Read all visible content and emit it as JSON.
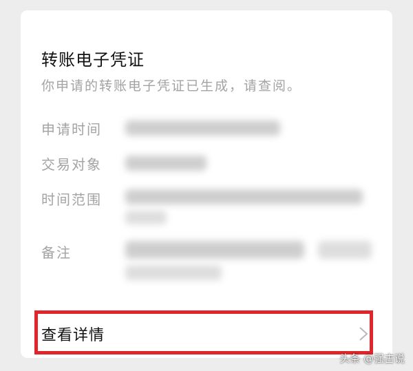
{
  "card": {
    "title": "转账电子凭证",
    "subtitle": "你申请的转账电子凭证已生成，请查阅。",
    "rows": [
      {
        "label": "申请时间"
      },
      {
        "label": "交易对象"
      },
      {
        "label": "时间范围"
      },
      {
        "label": "备注"
      }
    ],
    "detail_link": "查看详情"
  },
  "watermark": "头条 @强古说",
  "colors": {
    "highlight": "#e0262b",
    "background": "#ededed",
    "card": "#ffffff"
  },
  "icons": {
    "chevron": "chevron-right-icon"
  }
}
